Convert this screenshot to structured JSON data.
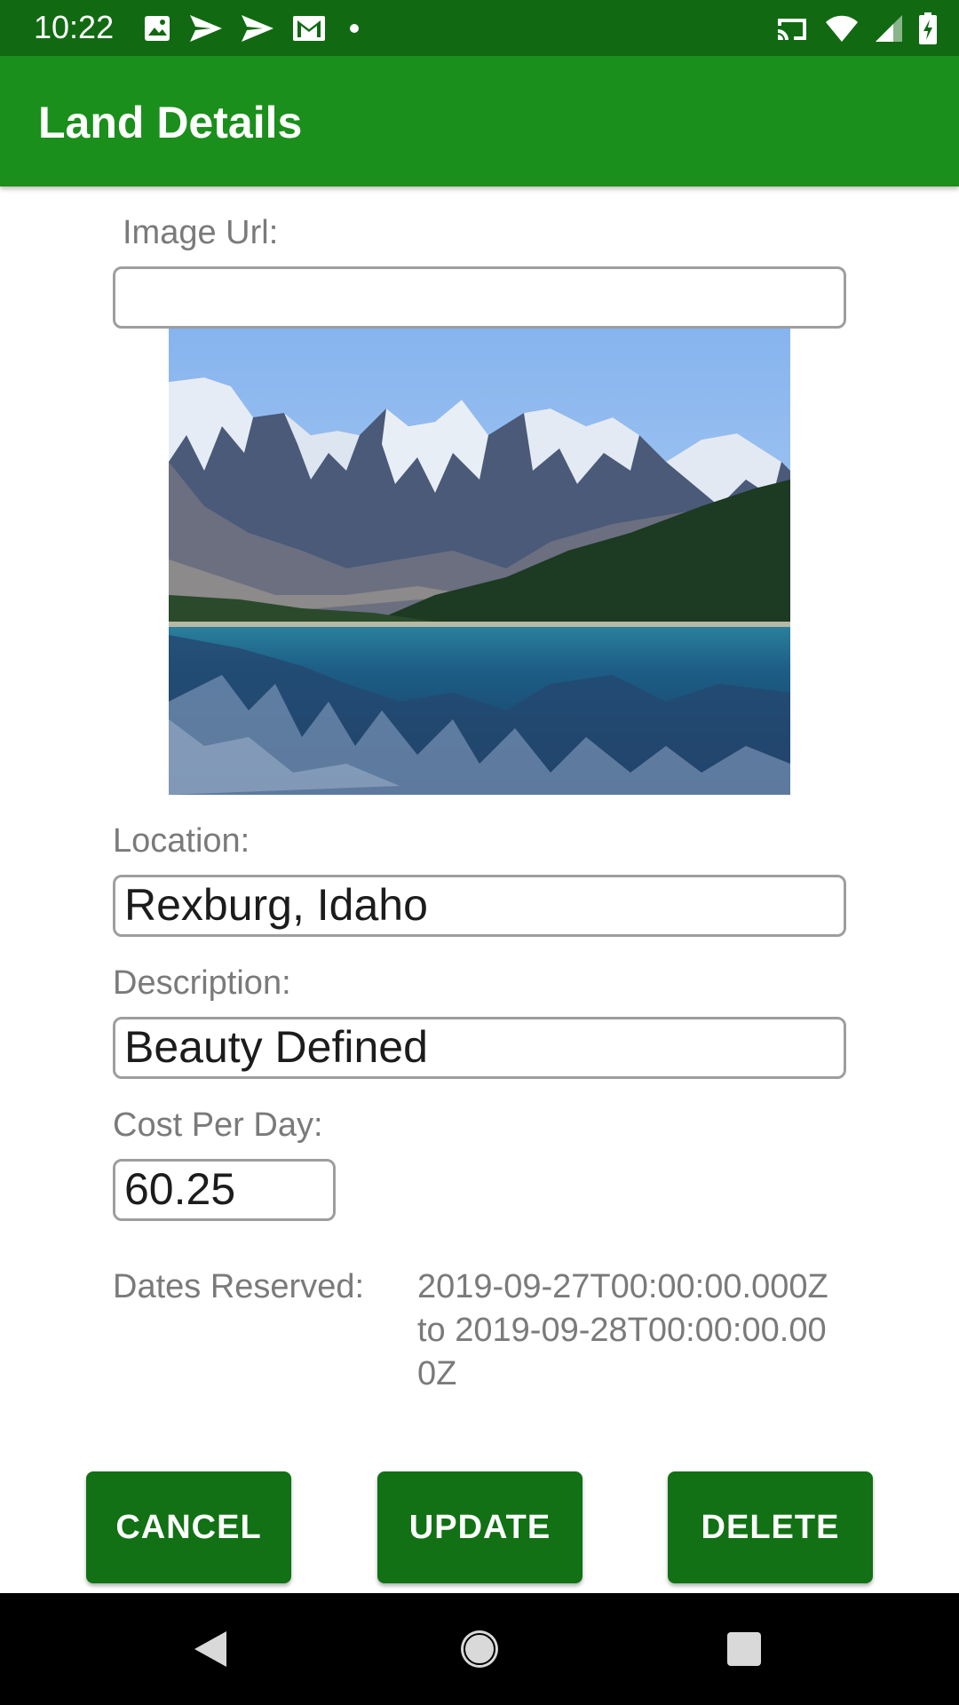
{
  "status_bar": {
    "time": "10:22",
    "left_icons": [
      "image-icon",
      "send-icon",
      "send-icon",
      "gmail-icon",
      "dot-icon"
    ],
    "right_icons": [
      "cast-icon",
      "wifi-icon",
      "signal-icon",
      "battery-charging-icon"
    ]
  },
  "app_bar": {
    "title": "Land Details"
  },
  "form": {
    "image_url_label": "Image Url:",
    "image_url_value": "",
    "location_label": "Location:",
    "location_value": "Rexburg, Idaho",
    "description_label": "Description:",
    "description_value": "Beauty Defined",
    "cost_label": "Cost Per Day:",
    "cost_value": "60.25",
    "dates_label": "Dates Reserved:",
    "dates_value": "2019-09-27T00:00:00.000Z to 2019-09-28T00:00:00.000Z"
  },
  "buttons": {
    "cancel": "CANCEL",
    "update": "UPDATE",
    "delete": "DELETE"
  },
  "nav_bar": {
    "icons": [
      "back-icon",
      "home-icon",
      "recents-icon"
    ]
  },
  "colors": {
    "status_bar": "#116a12",
    "app_bar": "#1a8f1b",
    "button": "#117114"
  }
}
